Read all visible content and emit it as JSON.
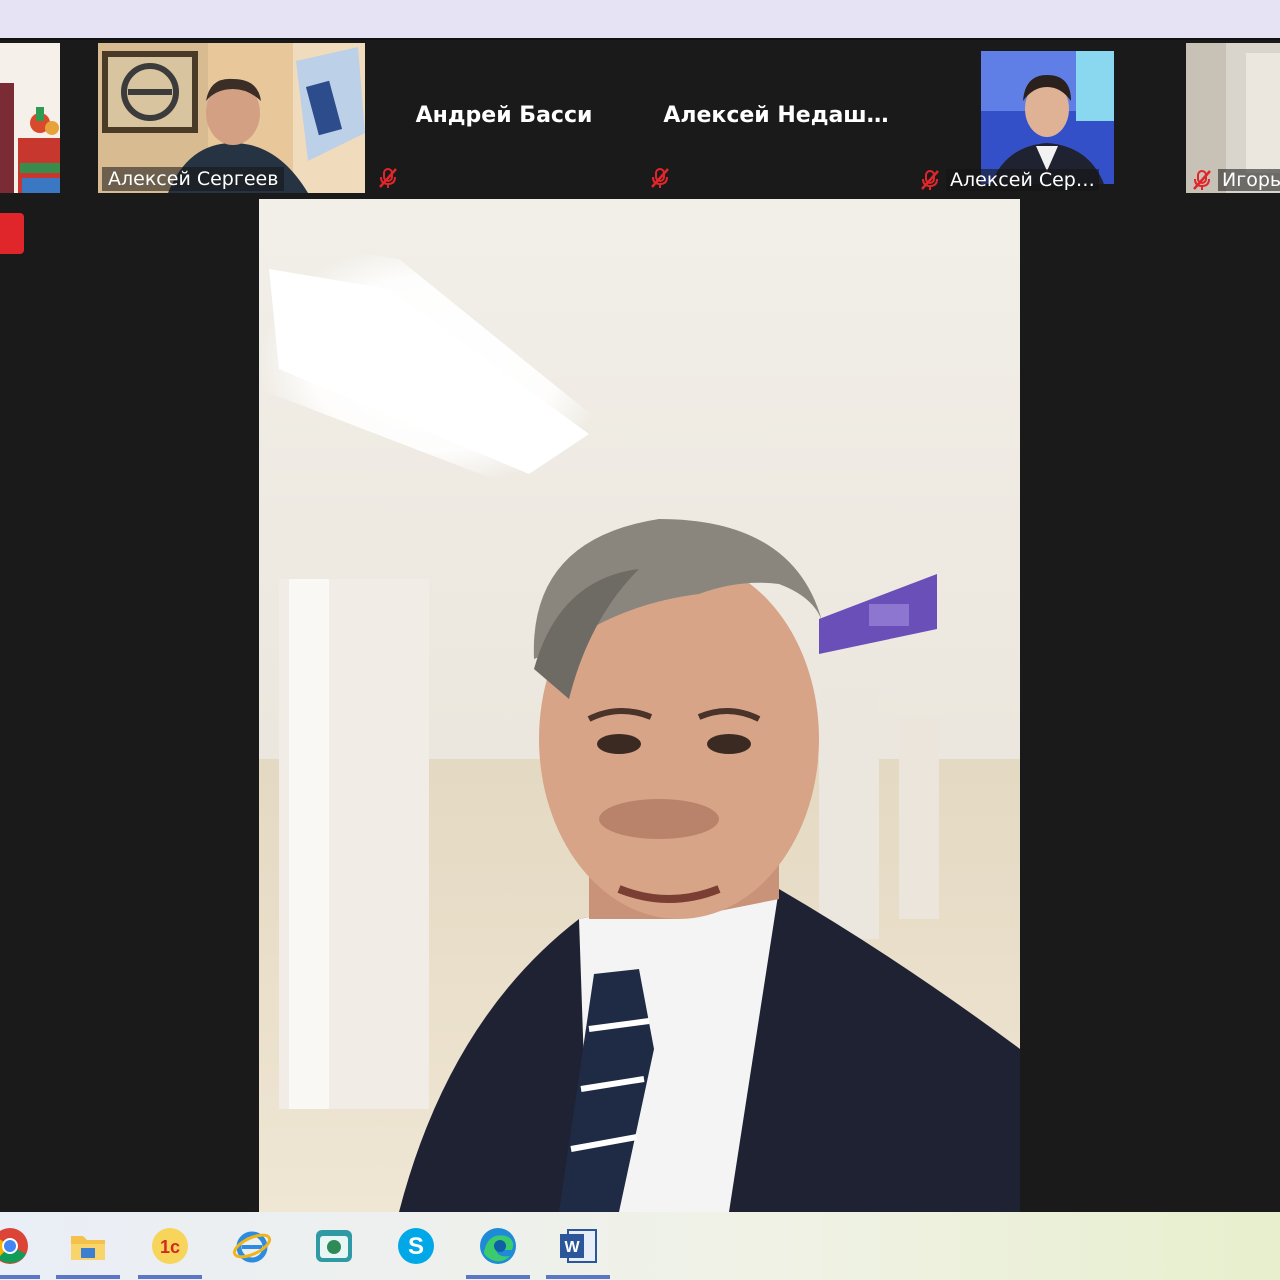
{
  "participants": [
    {
      "name": ""
    },
    {
      "name": "Алексей Сергеев"
    },
    {
      "name": "Андрей Басси"
    },
    {
      "name": "Алексей  Недаш…"
    },
    {
      "name": "Алексей Сер…"
    },
    {
      "name": "Игорь"
    }
  ],
  "icons": {
    "mute": "microphone-muted-icon",
    "taskbar": [
      "chrome-icon",
      "file-explorer-icon",
      "1c-icon",
      "internet-explorer-icon",
      "backup-app-icon",
      "skype-icon",
      "edge-icon",
      "word-icon"
    ]
  },
  "colors": {
    "top_bar": "#e6e3f4",
    "stage_bg": "#1a1a1a",
    "mute_red": "#e0262b",
    "taskbar_active": "#5b76c7"
  }
}
